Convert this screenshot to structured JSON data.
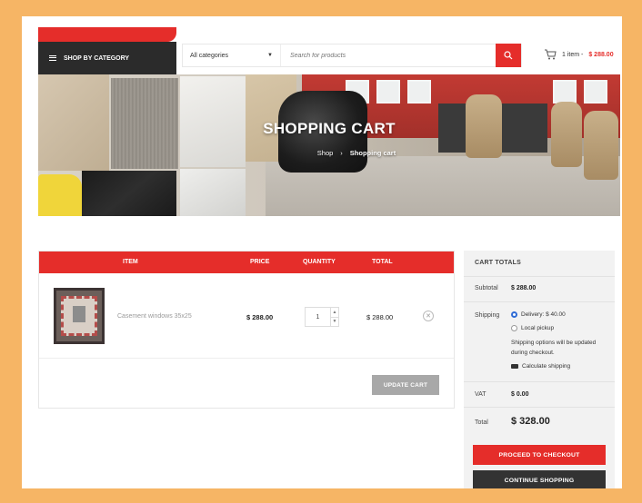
{
  "header": {
    "category_button_label": "SHOP BY CATEGORY",
    "category_select_value": "All categories",
    "search_placeholder": "Search for products",
    "cart_summary": "1 item - ",
    "cart_amount": "$ 288.00"
  },
  "hero": {
    "title": "SHOPPING CART",
    "breadcrumb": {
      "home": "Shop",
      "separator": "›",
      "current": "Shopping cart"
    }
  },
  "cart_table": {
    "columns": [
      "ITEM",
      "PRICE",
      "QUANTITY",
      "TOTAL"
    ],
    "items": [
      {
        "name": "Casement windows 35x25",
        "price": "$ 288.00",
        "quantity": "1",
        "total": "$ 288.00"
      }
    ],
    "update_label": "UPDATE CART"
  },
  "totals": {
    "title": "CART TOTALS",
    "subtotal_label": "Subtotal",
    "subtotal_value": "$ 288.00",
    "shipping_label": "Shipping",
    "shipping_options": [
      "Delivery: $ 40.00",
      "Local pickup"
    ],
    "shipping_note": "Shipping options will be updated during checkout.",
    "calculate_label": "Calculate shipping",
    "vat_label": "VAT",
    "vat_value": "$ 0.00",
    "total_label": "Total",
    "total_value": "$ 328.00",
    "checkout_label": "PROCEED TO CHECKOUT",
    "continue_label": "CONTINUE SHOPPING"
  },
  "colors": {
    "accent": "#e52d2a",
    "page_border": "#f6b565",
    "dark": "#2b2b2b"
  },
  "icons": [
    "menu-icon",
    "caret-down-icon",
    "search-icon",
    "cart-icon",
    "remove-icon",
    "truck-icon"
  ]
}
